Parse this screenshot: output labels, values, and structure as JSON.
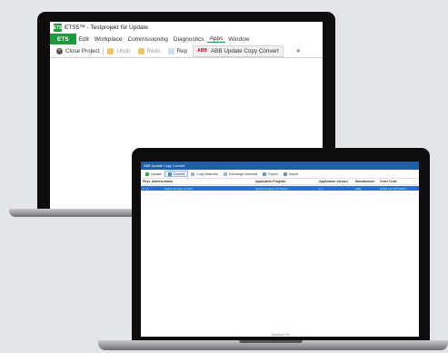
{
  "back_window": {
    "title": "ETS5™ - Testprojekt für Update",
    "logo_letters": "ETS",
    "menu": {
      "ets_tab": "ETS",
      "items": [
        "Edit",
        "Workplace",
        "Commissioning",
        "Diagnostics",
        "Apps",
        "Window"
      ],
      "active": "Apps"
    },
    "toolbar": {
      "close_project": "Close Project",
      "undo": "Undo",
      "redo": "Redo",
      "reports": "Rep",
      "app_tab": "ABB Update Copy Convert",
      "abb_logo": "ABB",
      "tab_close": "✕"
    }
  },
  "front_window": {
    "title": "ABB Update Copy Convert",
    "toolbar": {
      "update": "Update",
      "convert": "Convert",
      "copy_channels": "Copy channels",
      "exchange_channels": "Exchange channels",
      "export": "Export",
      "import": "Import"
    },
    "columns": {
      "phys_address": "Phys. Address",
      "name": "Name",
      "application_program": "Application Program",
      "application_version": "Application Version",
      "manufacturer": "Manufacturer",
      "order_code": "Order Code"
    },
    "selected_row": {
      "phys_address": "1.1.1",
      "name": "Switch Actuator 12-fold",
      "application_program": "Switch Actuator 12f 16A/1.1",
      "application_version": "1.1",
      "manufacturer": "ABB",
      "order_code": "2CDG 110 155 R0011"
    },
    "laptop_brand": "MacBook Pro"
  },
  "colors": {
    "ets_green": "#1f9b3d",
    "abb_red": "#e2001a",
    "title_blue": "#1f5fa8",
    "selection_blue": "#2a6fd1"
  }
}
